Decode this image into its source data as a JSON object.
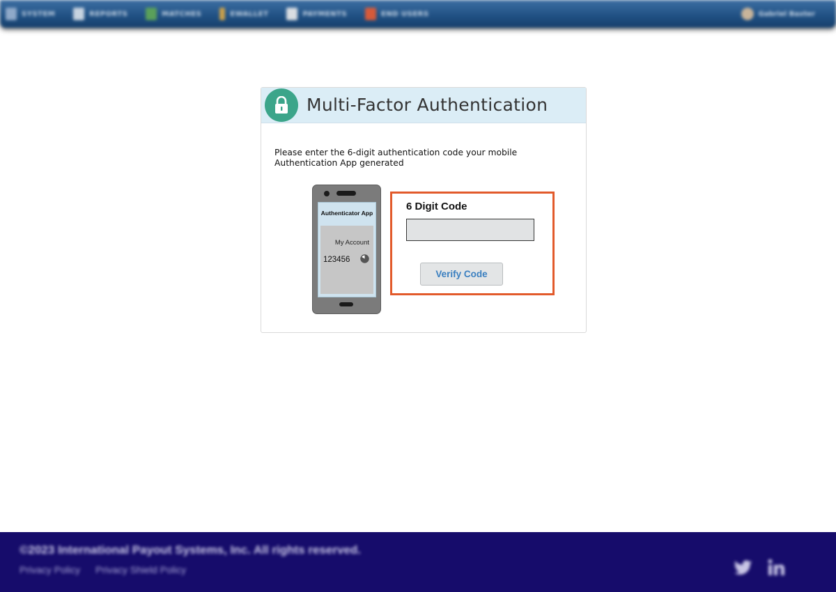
{
  "nav": {
    "items": [
      {
        "label": "SYSTEM",
        "icon": "system-icon",
        "color": "#8fa9c9"
      },
      {
        "label": "REPORTS",
        "icon": "reports-icon",
        "color": "#c7d3e0"
      },
      {
        "label": "MATCHES",
        "icon": "matches-icon",
        "color": "#5aa05a"
      },
      {
        "label": "EWALLET",
        "icon": "ewallet-icon",
        "color": "#c9a04a"
      },
      {
        "label": "PAYMENTS",
        "icon": "payments-icon",
        "color": "#d9dde2"
      },
      {
        "label": "END USERS",
        "icon": "end-users-icon",
        "color": "#d65a3a"
      }
    ],
    "user": {
      "label": "Gabriel Baxter",
      "icon": "user-avatar-icon"
    }
  },
  "card": {
    "title": "Multi-Factor Authentication",
    "icon": "lock-icon",
    "instructions": "Please enter the 6-digit authentication code your mobile Authentication App generated",
    "phone": {
      "app_title": "Authenticator App",
      "account": "My Account",
      "code": "123456",
      "timer_icon": "timer-icon"
    },
    "form": {
      "label": "6 Digit Code",
      "value": "",
      "placeholder": "",
      "button_label": "Verify Code"
    }
  },
  "footer": {
    "copyright": "©2023 International Payout Systems, Inc. All rights reserved.",
    "links": [
      "Privacy Policy",
      "Privacy Shield Policy"
    ],
    "social": [
      "twitter-icon",
      "linkedin-icon"
    ]
  },
  "colors": {
    "accent_border": "#e25a2b",
    "header_bg": "#dbedf6",
    "lock_green": "#3ca58a",
    "button_text": "#3a7fc0",
    "footer_bg": "#160c6b",
    "nav_bg": "#1f4f82"
  }
}
